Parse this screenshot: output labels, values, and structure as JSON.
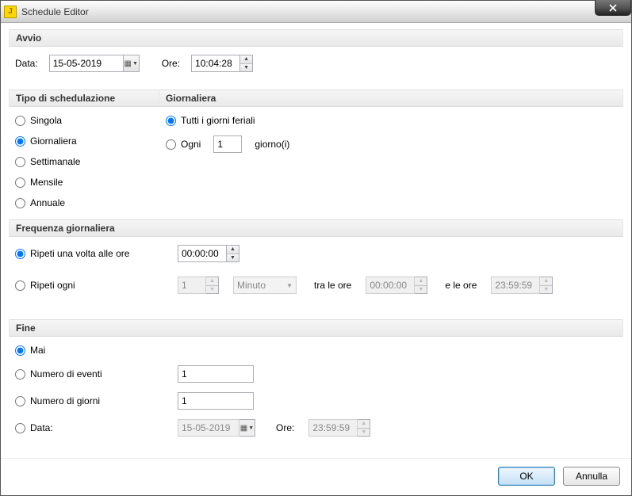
{
  "window": {
    "title": "Schedule Editor"
  },
  "avvio": {
    "header": "Avvio",
    "data_label": "Data:",
    "data_value": "15-05-2019",
    "ore_label": "Ore:",
    "ore_value": "10:04:28"
  },
  "tipo": {
    "header": "Tipo di schedulazione",
    "options": {
      "singola": "Singola",
      "giornaliera": "Giornaliera",
      "settimanale": "Settimanale",
      "mensile": "Mensile",
      "annuale": "Annuale"
    },
    "selected": "giornaliera"
  },
  "giornaliera": {
    "header": "Giornaliera",
    "tutti_feriali": "Tutti i giorni feriali",
    "ogni": "Ogni",
    "ogni_value": "1",
    "ogni_suffix": "giorno(i)",
    "selected": "tutti_feriali"
  },
  "frequenza": {
    "header": "Frequenza giornaliera",
    "ripeti_una_volta": "Ripeti una volta alle ore",
    "ripeti_una_volta_time": "00:00:00",
    "ripeti_ogni": "Ripeti ogni",
    "ripeti_ogni_value": "1",
    "ripeti_ogni_unit": "Minuto",
    "tra_le_ore": "tra le ore",
    "tra_time": "00:00:00",
    "e_le_ore": "e le ore",
    "e_time": "23:59:59",
    "selected": "ripeti_una_volta"
  },
  "fine": {
    "header": "Fine",
    "mai": "Mai",
    "numero_eventi": "Numero di eventi",
    "numero_eventi_value": "1",
    "numero_giorni": "Numero di giorni",
    "numero_giorni_value": "1",
    "data_label": "Data:",
    "data_value": "15-05-2019",
    "ore_label": "Ore:",
    "ore_value": "23:59:59",
    "selected": "mai"
  },
  "buttons": {
    "ok": "OK",
    "annulla": "Annulla"
  }
}
